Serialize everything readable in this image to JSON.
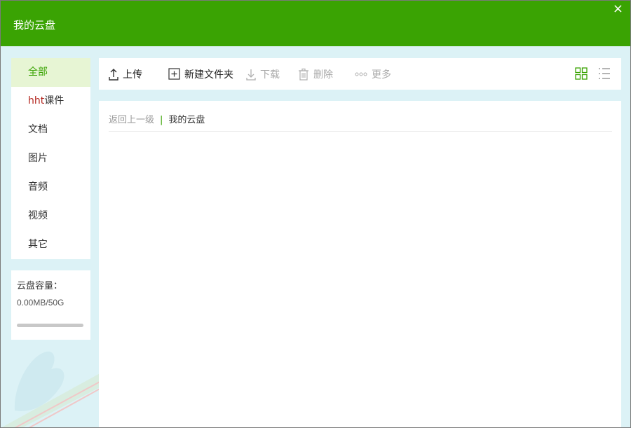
{
  "window": {
    "title": "我的云盘",
    "close_label": "×"
  },
  "sidebar": {
    "items": [
      {
        "label": "全部",
        "active": true
      },
      {
        "prefix": "hht",
        "label": "课件"
      },
      {
        "label": "文档"
      },
      {
        "label": "图片"
      },
      {
        "label": "音频"
      },
      {
        "label": "视频"
      },
      {
        "label": "其它"
      }
    ]
  },
  "storage": {
    "label": "云盘容量：",
    "value": "0.00MB/50G",
    "used_fraction": 0.0
  },
  "toolbar": {
    "upload": "上传",
    "new_folder": "新建文件夹",
    "download": "下载",
    "delete": "删除",
    "more": "更多"
  },
  "breadcrumb": {
    "back": "返回上一级",
    "separator": "|",
    "current": "我的云盘"
  },
  "colors": {
    "accent": "#3aa303",
    "background": "#dcf2f6"
  }
}
